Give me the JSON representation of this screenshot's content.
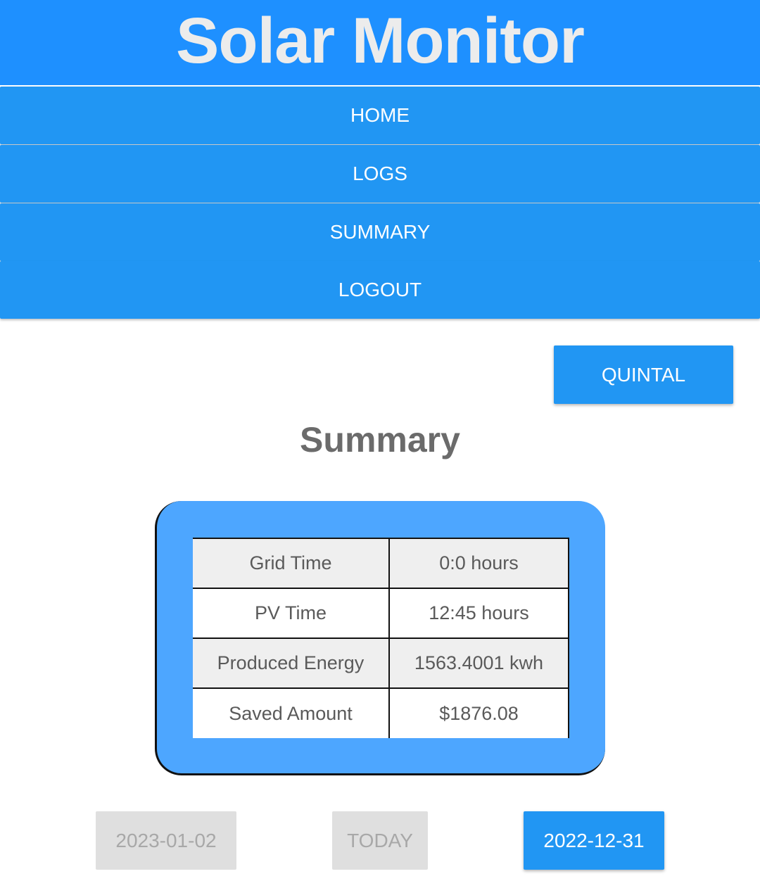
{
  "header": {
    "title": "Solar Monitor"
  },
  "nav": [
    {
      "label": "HOME"
    },
    {
      "label": "LOGS"
    },
    {
      "label": "SUMMARY"
    },
    {
      "label": "LOGOUT"
    }
  ],
  "location_button": {
    "label": "QUINTAL"
  },
  "summary": {
    "title": "Summary",
    "rows": [
      {
        "label": "Grid Time",
        "value": "0:0 hours"
      },
      {
        "label": "PV Time",
        "value": "12:45 hours"
      },
      {
        "label": "Produced Energy",
        "value": "1563.4001 kwh"
      },
      {
        "label": "Saved Amount",
        "value": "$1876.08"
      }
    ]
  },
  "date_nav": {
    "next": {
      "label": "2023-01-02",
      "enabled": false
    },
    "today": {
      "label": "TODAY",
      "enabled": false
    },
    "prev": {
      "label": "2022-12-31",
      "enabled": true
    }
  },
  "colors": {
    "header": "#1e90ff",
    "nav": "#2196f3",
    "card": "#4da6ff",
    "disabled": "#dfdfdf"
  }
}
